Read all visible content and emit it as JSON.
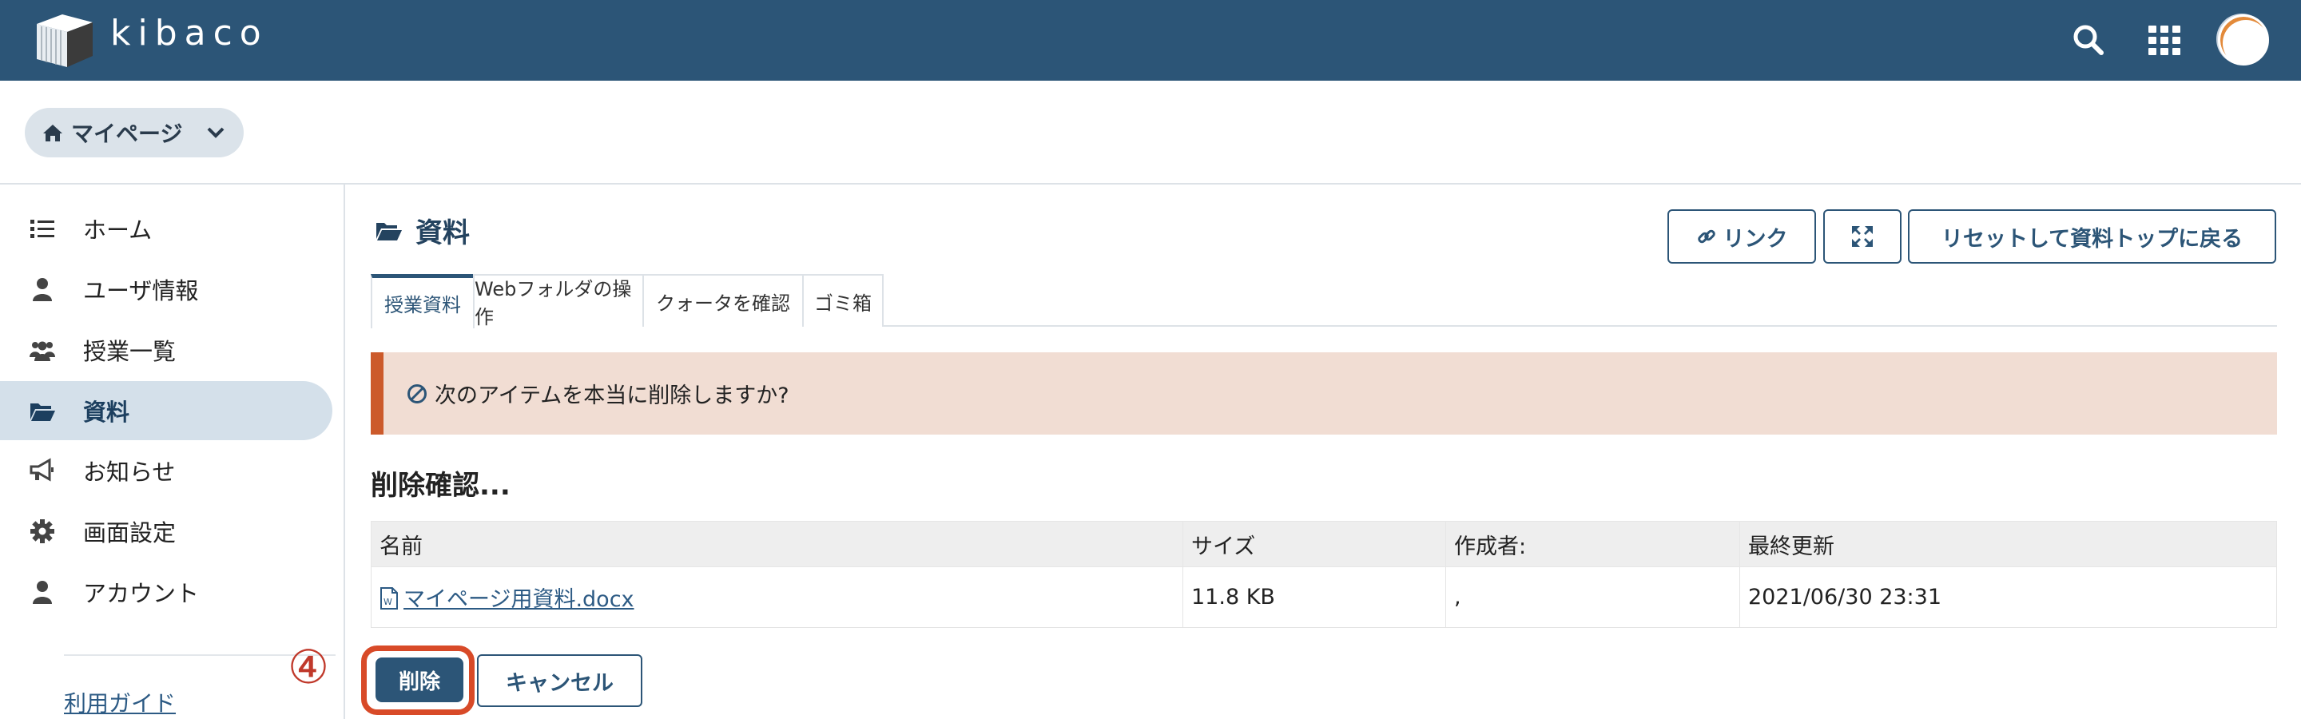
{
  "header": {
    "logo_text": "kibaco"
  },
  "mypage": {
    "label": "マイページ"
  },
  "sidebar": {
    "items": [
      {
        "label": "ホーム"
      },
      {
        "label": "ユーザ情報"
      },
      {
        "label": "授業一覧"
      },
      {
        "label": "資料"
      },
      {
        "label": "お知らせ"
      },
      {
        "label": "画面設定"
      },
      {
        "label": "アカウント"
      }
    ],
    "guide_link": "利用ガイド"
  },
  "main": {
    "title": "資料",
    "buttons": {
      "link": "リンク",
      "reset": "リセットして資料トップに戻る"
    },
    "tabs": [
      {
        "label": "授業資料"
      },
      {
        "label": "Webフォルダの操作"
      },
      {
        "label": "クォータを確認"
      },
      {
        "label": "ゴミ箱"
      }
    ],
    "alert": "次のアイテムを本当に削除しますか?",
    "confirm_heading": "削除確認...",
    "table": {
      "columns": [
        "名前",
        "サイズ",
        "作成者:",
        "最終更新"
      ],
      "rows": [
        {
          "name": "マイページ用資料.docx",
          "size": "11.8 KB",
          "creator": ",",
          "modified": "2021/06/30 23:31"
        }
      ]
    },
    "actions": {
      "delete": "削除",
      "cancel": "キャンセル"
    },
    "step_marker": "④"
  },
  "colors": {
    "header_bg": "#2c5577",
    "accent": "#2c5577",
    "alert_bg": "#f1ddd3",
    "alert_border": "#cc5a2b",
    "highlight": "#d84a28"
  },
  "icons": [
    "cube-logo-icon",
    "search-icon",
    "apps-grid-icon",
    "home-icon",
    "chevron-down-icon",
    "list-icon",
    "user-icon",
    "users-icon",
    "folder-open-icon",
    "bullhorn-icon",
    "gear-icon",
    "link-icon",
    "expand-icon",
    "ban-icon",
    "word-file-icon"
  ]
}
